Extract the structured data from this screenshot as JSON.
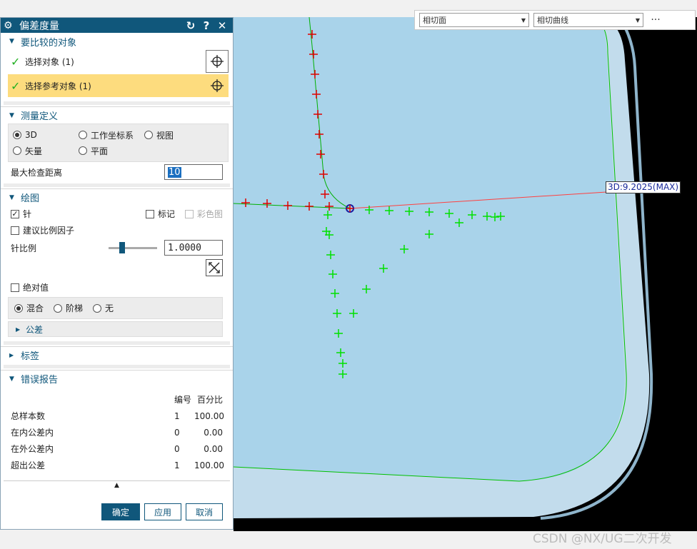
{
  "dialog": {
    "title": "偏差度量",
    "reset_glyph": "↻",
    "help_glyph": "?",
    "close_glyph": "✕",
    "sections": {
      "objects": {
        "title": "要比较的对象",
        "select_object": "选择对象 (1)",
        "select_reference": "选择参考对象 (1)"
      },
      "measure": {
        "title": "测量定义",
        "options": [
          "3D",
          "工作坐标系",
          "视图",
          "矢量",
          "平面"
        ],
        "selected": "3D",
        "max_distance_label": "最大检查距离",
        "max_distance_value": "10"
      },
      "drawing": {
        "title": "绘图",
        "needle_label": "针",
        "needle_checked": true,
        "mark_label": "标记",
        "color_label": "彩色图",
        "suggest_scale_label": "建议比例因子",
        "needle_scale_label": "针比例",
        "needle_scale_value": "1.0000",
        "slider_level": 0.25,
        "absolute_label": "绝对值",
        "mode_options": [
          "混合",
          "阶梯",
          "无"
        ],
        "mode_selected": "混合",
        "tolerance_label": "公差"
      },
      "labels": {
        "title": "标签"
      },
      "report": {
        "title": "错误报告",
        "col_number": "编号",
        "col_percent": "百分比",
        "rows": [
          {
            "label": "总样本数",
            "number": "1",
            "percent": "100.00"
          },
          {
            "label": "在内公差内",
            "number": "0",
            "percent": "0.00"
          },
          {
            "label": "在外公差内",
            "number": "0",
            "percent": "0.00"
          },
          {
            "label": "超出公差",
            "number": "1",
            "percent": "100.00"
          }
        ]
      }
    },
    "buttons": {
      "ok": "确定",
      "apply": "应用",
      "cancel": "取消"
    }
  },
  "viewport": {
    "toolbar": {
      "select1": "相切面",
      "select2": "相切曲线",
      "more": "···"
    },
    "max_label": "3D:9.2025(MAX)"
  },
  "watermark": "CSDN @NX/UG二次开发",
  "colors": {
    "title_bar": "#10577b",
    "selection_highlight": "#fddc7e",
    "surface": "#a9d3ea",
    "rim": "#c4dfef",
    "needle_green": "#00e000",
    "needle_red": "#e00000"
  }
}
